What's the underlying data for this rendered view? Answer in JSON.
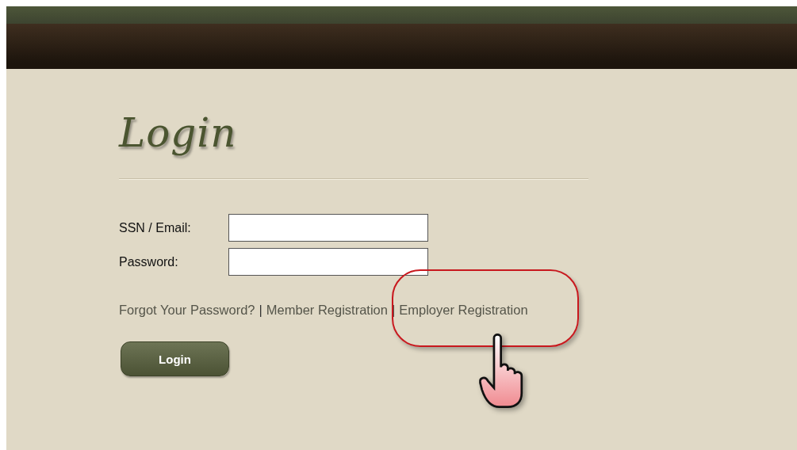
{
  "title": "Login",
  "fields": [
    {
      "label": "SSN / Email:"
    },
    {
      "label": "Password:"
    }
  ],
  "links": [
    {
      "text": "Forgot Your Password?",
      "highlighted": false
    },
    {
      "text": "Member Registration",
      "highlighted": false
    },
    {
      "text": "Employer Registration",
      "highlighted": true
    }
  ],
  "separators": [
    "|",
    "|"
  ],
  "button": "Login"
}
